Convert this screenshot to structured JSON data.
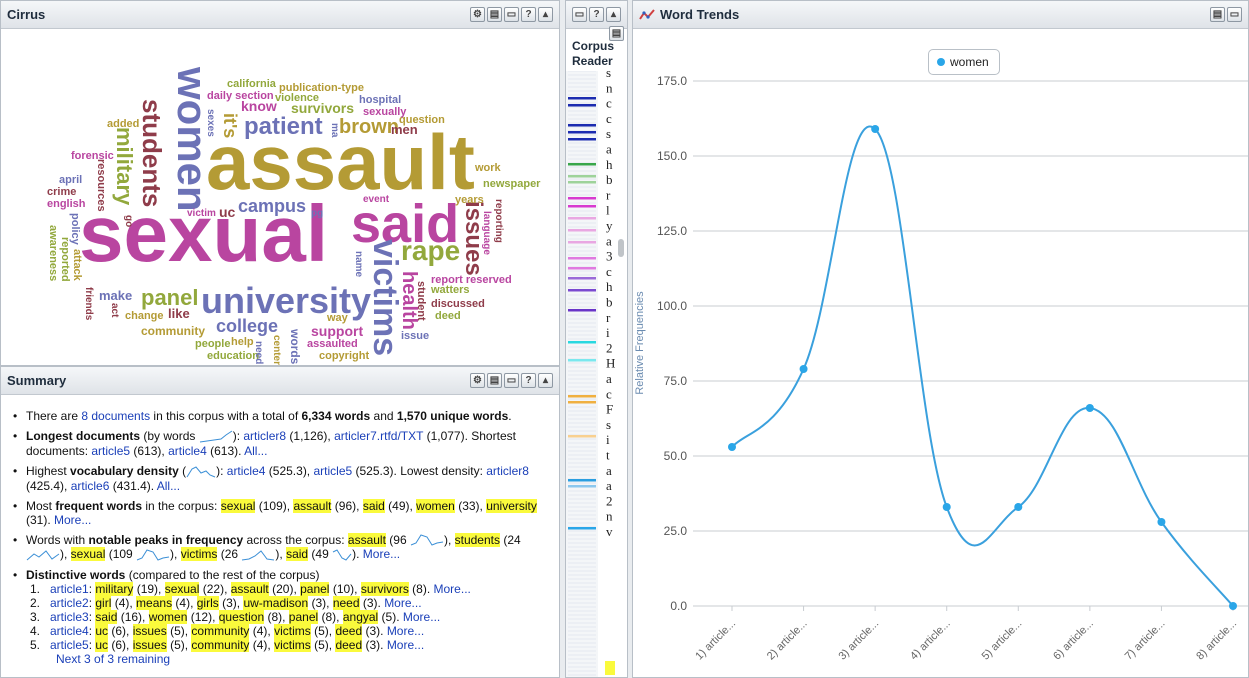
{
  "cirrus": {
    "title": "Cirrus",
    "words": [
      {
        "t": "sexual",
        "x": 78,
        "y": 165,
        "s": 80,
        "c": "#b945a0",
        "r": 0
      },
      {
        "t": "assault",
        "x": 205,
        "y": 94,
        "s": 78,
        "c": "#b49b35",
        "r": 0
      },
      {
        "t": "women",
        "x": 170,
        "y": 38,
        "s": 42,
        "c": "#6c72b6",
        "r": 90
      },
      {
        "t": "students",
        "x": 138,
        "y": 70,
        "s": 26,
        "c": "#8f3c4a",
        "r": 90
      },
      {
        "t": "said",
        "x": 350,
        "y": 168,
        "s": 54,
        "c": "#b945a0",
        "r": 0
      },
      {
        "t": "university",
        "x": 200,
        "y": 254,
        "s": 36,
        "c": "#6c72b6",
        "r": 0
      },
      {
        "t": "victims",
        "x": 367,
        "y": 210,
        "s": 34,
        "c": "#6c72b6",
        "r": 90
      },
      {
        "t": "rape",
        "x": 400,
        "y": 208,
        "s": 28,
        "c": "#92a83c",
        "r": 0
      },
      {
        "t": "issues",
        "x": 460,
        "y": 172,
        "s": 24,
        "c": "#8f3c4a",
        "r": 90
      },
      {
        "t": "health",
        "x": 398,
        "y": 242,
        "s": 20,
        "c": "#b945a0",
        "r": 90
      },
      {
        "t": "military",
        "x": 112,
        "y": 98,
        "s": 22,
        "c": "#92a83c",
        "r": 90
      },
      {
        "t": "patient",
        "x": 243,
        "y": 86,
        "s": 24,
        "c": "#6c72b6",
        "r": 0
      },
      {
        "t": "brown",
        "x": 338,
        "y": 88,
        "s": 20,
        "c": "#b49b35",
        "r": 0
      },
      {
        "t": "campus",
        "x": 237,
        "y": 168,
        "s": 18,
        "c": "#6c72b6",
        "r": 0
      },
      {
        "t": "panel",
        "x": 140,
        "y": 258,
        "s": 22,
        "c": "#92a83c",
        "r": 0
      },
      {
        "t": "college",
        "x": 215,
        "y": 288,
        "s": 18,
        "c": "#6c72b6",
        "r": 0
      },
      {
        "t": "support",
        "x": 310,
        "y": 295,
        "s": 14,
        "c": "#b945a0",
        "r": 0
      },
      {
        "t": "it's",
        "x": 220,
        "y": 84,
        "s": 18,
        "c": "#b49b35",
        "r": 90
      },
      {
        "t": "know",
        "x": 240,
        "y": 70,
        "s": 14,
        "c": "#b945a0",
        "r": 0
      },
      {
        "t": "survivors",
        "x": 290,
        "y": 72,
        "s": 14,
        "c": "#92a83c",
        "r": 0
      },
      {
        "t": "make",
        "x": 98,
        "y": 260,
        "s": 13,
        "c": "#6c72b6",
        "r": 0
      },
      {
        "t": "like",
        "x": 167,
        "y": 278,
        "s": 13,
        "c": "#8f3c4a",
        "r": 0
      },
      {
        "t": "community",
        "x": 140,
        "y": 296,
        "s": 12,
        "c": "#b49b35",
        "r": 0
      },
      {
        "t": "way",
        "x": 326,
        "y": 284,
        "s": 11,
        "c": "#b49b35",
        "r": 0
      },
      {
        "t": "words",
        "x": 288,
        "y": 300,
        "s": 12,
        "c": "#6c72b6",
        "r": 90
      },
      {
        "t": "men",
        "x": 390,
        "y": 94,
        "s": 13,
        "c": "#8f3c4a",
        "r": 0
      },
      {
        "t": "question",
        "x": 398,
        "y": 86,
        "s": 11,
        "c": "#b49b35",
        "r": 0
      },
      {
        "t": "hospital",
        "x": 358,
        "y": 66,
        "s": 11,
        "c": "#6c72b6",
        "r": 0
      },
      {
        "t": "sexually",
        "x": 362,
        "y": 78,
        "s": 11,
        "c": "#b945a0",
        "r": 0
      },
      {
        "t": "publication-type",
        "x": 278,
        "y": 54,
        "s": 11,
        "c": "#b49b35",
        "r": 0
      },
      {
        "t": "california",
        "x": 226,
        "y": 50,
        "s": 11,
        "c": "#92a83c",
        "r": 0
      },
      {
        "t": "daily section",
        "x": 206,
        "y": 62,
        "s": 11,
        "c": "#b945a0",
        "r": 0
      },
      {
        "t": "violence",
        "x": 274,
        "y": 64,
        "s": 11,
        "c": "#92a83c",
        "r": 0
      },
      {
        "t": "added",
        "x": 106,
        "y": 90,
        "s": 11,
        "c": "#b49b35",
        "r": 0
      },
      {
        "t": "forensic",
        "x": 70,
        "y": 122,
        "s": 11,
        "c": "#b945a0",
        "r": 0
      },
      {
        "t": "resources",
        "x": 94,
        "y": 130,
        "s": 11,
        "c": "#8f3c4a",
        "r": 90
      },
      {
        "t": "april",
        "x": 58,
        "y": 146,
        "s": 11,
        "c": "#6c72b6",
        "r": 0
      },
      {
        "t": "crime",
        "x": 46,
        "y": 158,
        "s": 11,
        "c": "#8f3c4a",
        "r": 0
      },
      {
        "t": "english",
        "x": 46,
        "y": 170,
        "s": 11,
        "c": "#b945a0",
        "r": 0
      },
      {
        "t": "policy",
        "x": 68,
        "y": 184,
        "s": 11,
        "c": "#6c72b6",
        "r": 90
      },
      {
        "t": "awareness",
        "x": 46,
        "y": 196,
        "s": 11,
        "c": "#92a83c",
        "r": 90
      },
      {
        "t": "reported",
        "x": 58,
        "y": 208,
        "s": 11,
        "c": "#92a83c",
        "r": 90
      },
      {
        "t": "attack",
        "x": 70,
        "y": 220,
        "s": 11,
        "c": "#b49b35",
        "r": 90
      },
      {
        "t": "friends",
        "x": 82,
        "y": 258,
        "s": 10,
        "c": "#8f3c4a",
        "r": 90
      },
      {
        "t": "act",
        "x": 108,
        "y": 274,
        "s": 10,
        "c": "#8f3c4a",
        "r": 90
      },
      {
        "t": "change",
        "x": 124,
        "y": 282,
        "s": 11,
        "c": "#b49b35",
        "r": 0
      },
      {
        "t": "people",
        "x": 194,
        "y": 310,
        "s": 11,
        "c": "#92a83c",
        "r": 0
      },
      {
        "t": "education",
        "x": 206,
        "y": 322,
        "s": 11,
        "c": "#92a83c",
        "r": 0
      },
      {
        "t": "help",
        "x": 230,
        "y": 308,
        "s": 11,
        "c": "#b49b35",
        "r": 0
      },
      {
        "t": "need",
        "x": 252,
        "y": 312,
        "s": 10,
        "c": "#6c72b6",
        "r": 90
      },
      {
        "t": "center",
        "x": 270,
        "y": 306,
        "s": 10,
        "c": "#b49b35",
        "r": 90
      },
      {
        "t": "assaulted",
        "x": 306,
        "y": 310,
        "s": 11,
        "c": "#b945a0",
        "r": 0
      },
      {
        "t": "copyright",
        "x": 318,
        "y": 322,
        "s": 11,
        "c": "#b49b35",
        "r": 0
      },
      {
        "t": "issue",
        "x": 400,
        "y": 302,
        "s": 11,
        "c": "#6c72b6",
        "r": 0
      },
      {
        "t": "student",
        "x": 414,
        "y": 252,
        "s": 11,
        "c": "#8f3c4a",
        "r": 90
      },
      {
        "t": "report reserved",
        "x": 430,
        "y": 246,
        "s": 11,
        "c": "#b945a0",
        "r": 0
      },
      {
        "t": "watters",
        "x": 430,
        "y": 256,
        "s": 11,
        "c": "#92a83c",
        "r": 0
      },
      {
        "t": "discussed",
        "x": 430,
        "y": 270,
        "s": 11,
        "c": "#8f3c4a",
        "r": 0
      },
      {
        "t": "deed",
        "x": 434,
        "y": 282,
        "s": 11,
        "c": "#92a83c",
        "r": 0
      },
      {
        "t": "work",
        "x": 474,
        "y": 134,
        "s": 11,
        "c": "#b49b35",
        "r": 0
      },
      {
        "t": "newspaper",
        "x": 482,
        "y": 150,
        "s": 11,
        "c": "#92a83c",
        "r": 0
      },
      {
        "t": "years",
        "x": 454,
        "y": 166,
        "s": 11,
        "c": "#b49b35",
        "r": 0
      },
      {
        "t": "language",
        "x": 480,
        "y": 182,
        "s": 10,
        "c": "#b945a0",
        "r": 90
      },
      {
        "t": "reporting",
        "x": 492,
        "y": 170,
        "s": 10,
        "c": "#8f3c4a",
        "r": 90
      },
      {
        "t": "victim",
        "x": 186,
        "y": 180,
        "s": 10,
        "c": "#b945a0",
        "r": 0
      },
      {
        "t": "uc",
        "x": 218,
        "y": 176,
        "s": 14,
        "c": "#8f3c4a",
        "r": 0
      },
      {
        "t": "pg",
        "x": 310,
        "y": 180,
        "s": 10,
        "c": "#6c72b6",
        "r": 0
      },
      {
        "t": "event",
        "x": 362,
        "y": 166,
        "s": 10,
        "c": "#b945a0",
        "r": 0
      },
      {
        "t": "name",
        "x": 352,
        "y": 222,
        "s": 10,
        "c": "#6c72b6",
        "r": 90
      },
      {
        "t": "go",
        "x": 122,
        "y": 186,
        "s": 10,
        "c": "#8f3c4a",
        "r": 90
      },
      {
        "t": "sexes",
        "x": 204,
        "y": 80,
        "s": 10,
        "c": "#6c72b6",
        "r": 90
      },
      {
        "t": "ma",
        "x": 328,
        "y": 94,
        "s": 10,
        "c": "#6c72b6",
        "r": 90
      }
    ]
  },
  "summary": {
    "title": "Summary",
    "l1": {
      "a": "There are ",
      "docs": "8 documents",
      "b": " in this corpus with a total of ",
      "words": "6,334 words",
      "c": " and ",
      "unique": "1,570 unique words",
      "d": "."
    },
    "l2": {
      "bold": "Longest documents",
      "a": " (by words ",
      "b": "): ",
      "d1": "articler8",
      "d1v": " (1,126), ",
      "d2": "articler7.rtfd/TXT",
      "d2v": " (1,077). Shortest documents: ",
      "d3": "article5",
      "d3v": " (613), ",
      "d4": "article4",
      "d4v": " (613). ",
      "all": "All..."
    },
    "l3": {
      "a": "Highest ",
      "bold": "vocabulary density",
      "b": " (",
      "c": "): ",
      "d1": "article4",
      "d1v": " (525.3), ",
      "d2": "article5",
      "d2v": " (525.3). Lowest density: ",
      "d3": "articler8",
      "d3v": " (425.4), ",
      "d4": "article6",
      "d4v": " (431.4). ",
      "all": "All..."
    },
    "l4": {
      "a": "Most ",
      "bold": "frequent words",
      "b": " in the corpus: ",
      "w1": "sexual",
      "v1": " (109), ",
      "w2": "assault",
      "v2": " (96), ",
      "w3": "said",
      "v3": " (49), ",
      "w4": "women",
      "v4": " (33), ",
      "w5": "university",
      "v5": " (31). ",
      "more": "More..."
    },
    "l5": {
      "a": "Words with ",
      "bold": "notable peaks in frequency",
      "b": " across the corpus: ",
      "w1": "assault",
      "v1": " (96 ",
      "w2": "students",
      "v2": " (24 ",
      "w3": "sexual",
      "v3": " (109 ",
      "w4": "victims",
      "v4": " (26 ",
      "w5": "said",
      "v5": " (49 ",
      "close": "), ",
      "end": "). ",
      "more": "More..."
    },
    "l6": {
      "bold": "Distinctive words",
      "a": " (compared to the rest of the corpus)"
    },
    "dist": [
      {
        "n": "1.",
        "doc": "article1",
        "terms": [
          [
            "military",
            " (19), "
          ],
          [
            "sexual",
            " (22), "
          ],
          [
            "assault",
            " (20), "
          ],
          [
            "panel",
            " (10), "
          ],
          [
            "survivors",
            " (8). "
          ]
        ]
      },
      {
        "n": "2.",
        "doc": "article2",
        "terms": [
          [
            "girl",
            " (4), "
          ],
          [
            "means",
            " (4), "
          ],
          [
            "girls",
            " (3), "
          ],
          [
            "uw-madison",
            " (3), "
          ],
          [
            "need",
            " (3). "
          ]
        ]
      },
      {
        "n": "3.",
        "doc": "article3",
        "terms": [
          [
            "said",
            " (16), "
          ],
          [
            "women",
            " (12), "
          ],
          [
            "question",
            " (8), "
          ],
          [
            "panel",
            " (8), "
          ],
          [
            "angyal",
            " (5). "
          ]
        ]
      },
      {
        "n": "4.",
        "doc": "article4",
        "terms": [
          [
            "uc",
            " (6), "
          ],
          [
            "issues",
            " (5), "
          ],
          [
            "community",
            " (4), "
          ],
          [
            "victims",
            " (5), "
          ],
          [
            "deed",
            " (3). "
          ]
        ]
      },
      {
        "n": "5.",
        "doc": "article5",
        "terms": [
          [
            "uc",
            " (6), "
          ],
          [
            "issues",
            " (5), "
          ],
          [
            "community",
            " (4), "
          ],
          [
            "victims",
            " (5), "
          ],
          [
            "deed",
            " (3). "
          ]
        ]
      }
    ],
    "more": "More...",
    "next": "Next 3 of 3 remaining"
  },
  "reader": {
    "title_line1": "Corpus",
    "title_line2": "Reader",
    "chars": [
      "s",
      "n",
      "c",
      "c",
      "s",
      "a",
      "h",
      "b",
      "r",
      "l",
      "y",
      "a",
      "3",
      "c",
      "h",
      "b",
      "r",
      "i",
      "2",
      "H",
      "a",
      "c",
      "F",
      "s",
      "i",
      "t",
      "a",
      "a",
      "2",
      "n",
      "v"
    ],
    "marks": [
      {
        "y": 26,
        "c": "#1c2cb0"
      },
      {
        "y": 33,
        "c": "#1c2cb0"
      },
      {
        "y": 53,
        "c": "#1c2cb0"
      },
      {
        "y": 60,
        "c": "#1c2cb0"
      },
      {
        "y": 67,
        "c": "#1c2cb0"
      },
      {
        "y": 92,
        "c": "#3aa74a"
      },
      {
        "y": 104,
        "c": "#9ed39a"
      },
      {
        "y": 110,
        "c": "#9ed39a"
      },
      {
        "y": 126,
        "c": "#d83ad0"
      },
      {
        "y": 134,
        "c": "#d83ad0"
      },
      {
        "y": 146,
        "c": "#e9a7e2"
      },
      {
        "y": 158,
        "c": "#e9a7e2"
      },
      {
        "y": 170,
        "c": "#e9a7e2"
      },
      {
        "y": 186,
        "c": "#e07ae0"
      },
      {
        "y": 196,
        "c": "#e07ae0"
      },
      {
        "y": 206,
        "c": "#9b6ad8"
      },
      {
        "y": 218,
        "c": "#7b4ad0"
      },
      {
        "y": 238,
        "c": "#6a35c8"
      },
      {
        "y": 270,
        "c": "#28d8e0"
      },
      {
        "y": 288,
        "c": "#7ae8ee"
      },
      {
        "y": 324,
        "c": "#f0b040"
      },
      {
        "y": 330,
        "c": "#f0b040"
      },
      {
        "y": 364,
        "c": "#f8d090"
      },
      {
        "y": 408,
        "c": "#2a9ee0"
      },
      {
        "y": 414,
        "c": "#8cc8ee"
      },
      {
        "y": 456,
        "c": "#2aa6e8"
      }
    ]
  },
  "trends": {
    "title": "Word Trends",
    "legend": "women",
    "ylabel": "Relative Frequencies",
    "ticks": [
      "175.0",
      "150.0",
      "125.0",
      "100.0",
      "75.0",
      "50.0",
      "25.0",
      "0.0"
    ]
  },
  "chart_data": {
    "type": "line",
    "title": "",
    "ylabel": "Relative Frequencies",
    "categories": [
      "1) article...",
      "2) article...",
      "3) article...",
      "4) article...",
      "5) article...",
      "6) article...",
      "7) article...",
      "8) article..."
    ],
    "series": [
      {
        "name": "women",
        "values": [
          53,
          79,
          159,
          33,
          33,
          66,
          28,
          0
        ]
      }
    ],
    "ylim": [
      0,
      175
    ],
    "grid": true,
    "legend": "top-left",
    "colors": {
      "series": "#3aa0dd",
      "dot": "#2aa6e8"
    }
  }
}
